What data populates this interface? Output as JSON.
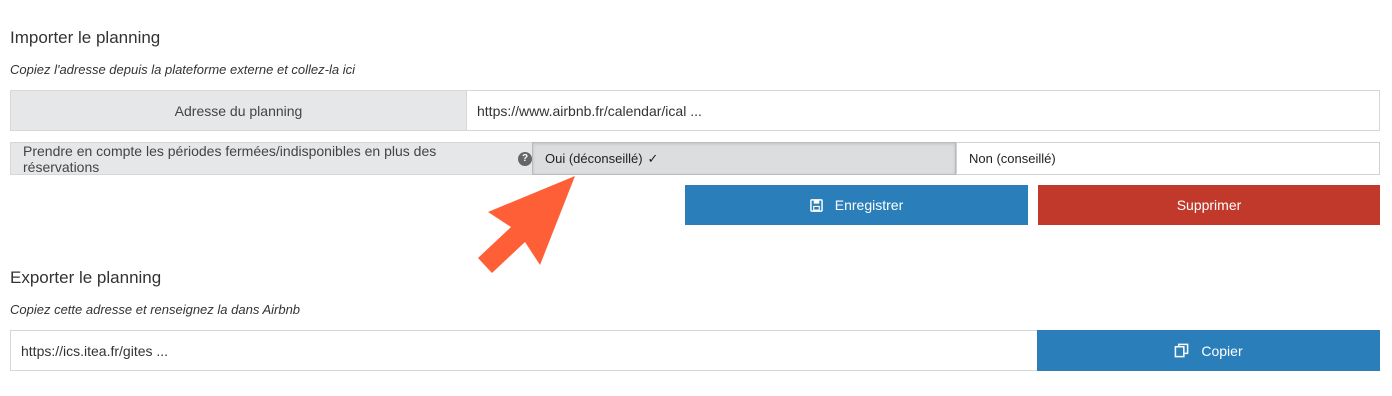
{
  "import": {
    "heading": "Importer le planning",
    "subtitle": "Copiez l'adresse depuis la plateforme externe et collez-la ici",
    "address_label": "Adresse du planning",
    "address_value": "https://www.airbnb.fr/calendar/ical ...",
    "closed_periods_label": "Prendre en compte les périodes fermées/indisponibles en plus des réservations",
    "help_icon_glyph": "?",
    "option_yes": "Oui (déconseillé)",
    "option_yes_check": "✓",
    "option_no": "Non (conseillé)",
    "save_label": "Enregistrer",
    "delete_label": "Supprimer"
  },
  "export": {
    "heading": "Exporter le planning",
    "subtitle": "Copiez cette adresse et renseignez la dans Airbnb",
    "address_value": "https://ics.itea.fr/gites ...",
    "copy_label": "Copier"
  },
  "colors": {
    "primary_button": "#2a7fba",
    "danger_button": "#c0392b",
    "annotation_arrow": "#ff5f36"
  },
  "icons": {
    "save": "floppy-disk-icon",
    "copy": "copy-icon",
    "check": "check-icon",
    "help": "question-circle-icon",
    "annotation": "arrow-annotation"
  }
}
